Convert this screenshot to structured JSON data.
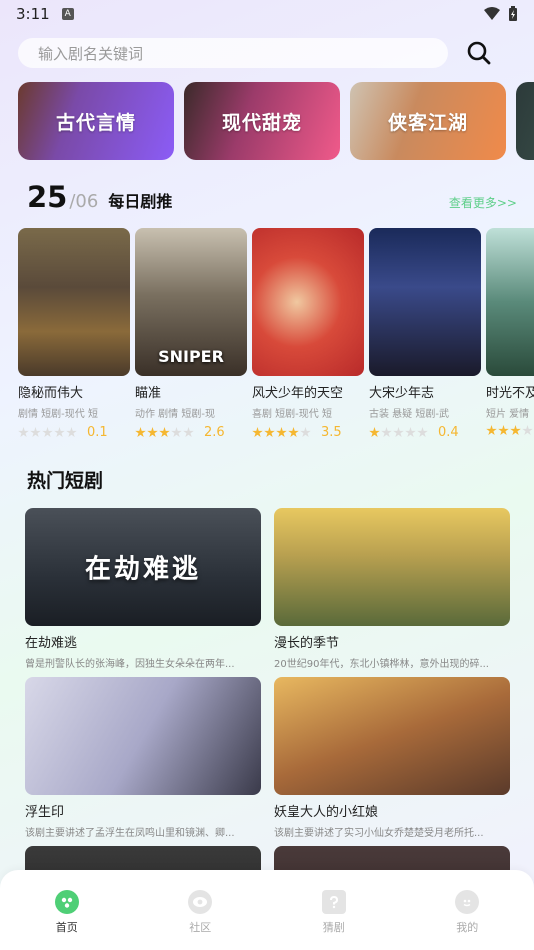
{
  "status": {
    "time": "3:11",
    "a_badge": "A"
  },
  "search": {
    "placeholder": "输入剧名关键词"
  },
  "categories": [
    {
      "label": "古代言情"
    },
    {
      "label": "现代甜宠"
    },
    {
      "label": "侠客江湖"
    }
  ],
  "daily": {
    "day": "25",
    "month": "/06",
    "title": "每日剧推",
    "more": "查看更多>>"
  },
  "movies": [
    {
      "title": "隐秘而伟大",
      "tags": "剧情  短剧-现代  短",
      "rating": "0.1",
      "stars": 0
    },
    {
      "title": "瞄准",
      "tags": "动作  剧情  短剧-现",
      "rating": "2.6",
      "stars": 3,
      "poster_text": "SNIPER"
    },
    {
      "title": "风犬少年的天空",
      "tags": "喜剧  短剧-现代  短",
      "rating": "3.5",
      "stars": 4
    },
    {
      "title": "大宋少年志",
      "tags": "古装  悬疑  短剧-武",
      "rating": "0.4",
      "stars": 1
    },
    {
      "title": "时光不及",
      "tags": "短片  爱情",
      "rating": "",
      "stars": 3
    }
  ],
  "hot": {
    "title": "热门短剧",
    "items": [
      {
        "name": "在劫难逃",
        "desc": "曾是刑警队长的张海峰，因独生女朵朵在两年...",
        "overlay": "在劫难逃"
      },
      {
        "name": "漫长的季节",
        "desc": "20世纪90年代，东北小镇桦林，意外出现的碎...",
        "overlay": ""
      },
      {
        "name": "浮生印",
        "desc": "该剧主要讲述了孟浮生在凤鸣山里和镜渊、卿...",
        "overlay": ""
      },
      {
        "name": "妖皇大人的小红娘",
        "desc": "该剧主要讲述了实习小仙女乔楚楚受月老所托...",
        "overlay": ""
      }
    ]
  },
  "tabbar": {
    "items": [
      {
        "label": "首页"
      },
      {
        "label": "社区"
      },
      {
        "label": "猜剧"
      },
      {
        "label": "我的"
      }
    ]
  }
}
